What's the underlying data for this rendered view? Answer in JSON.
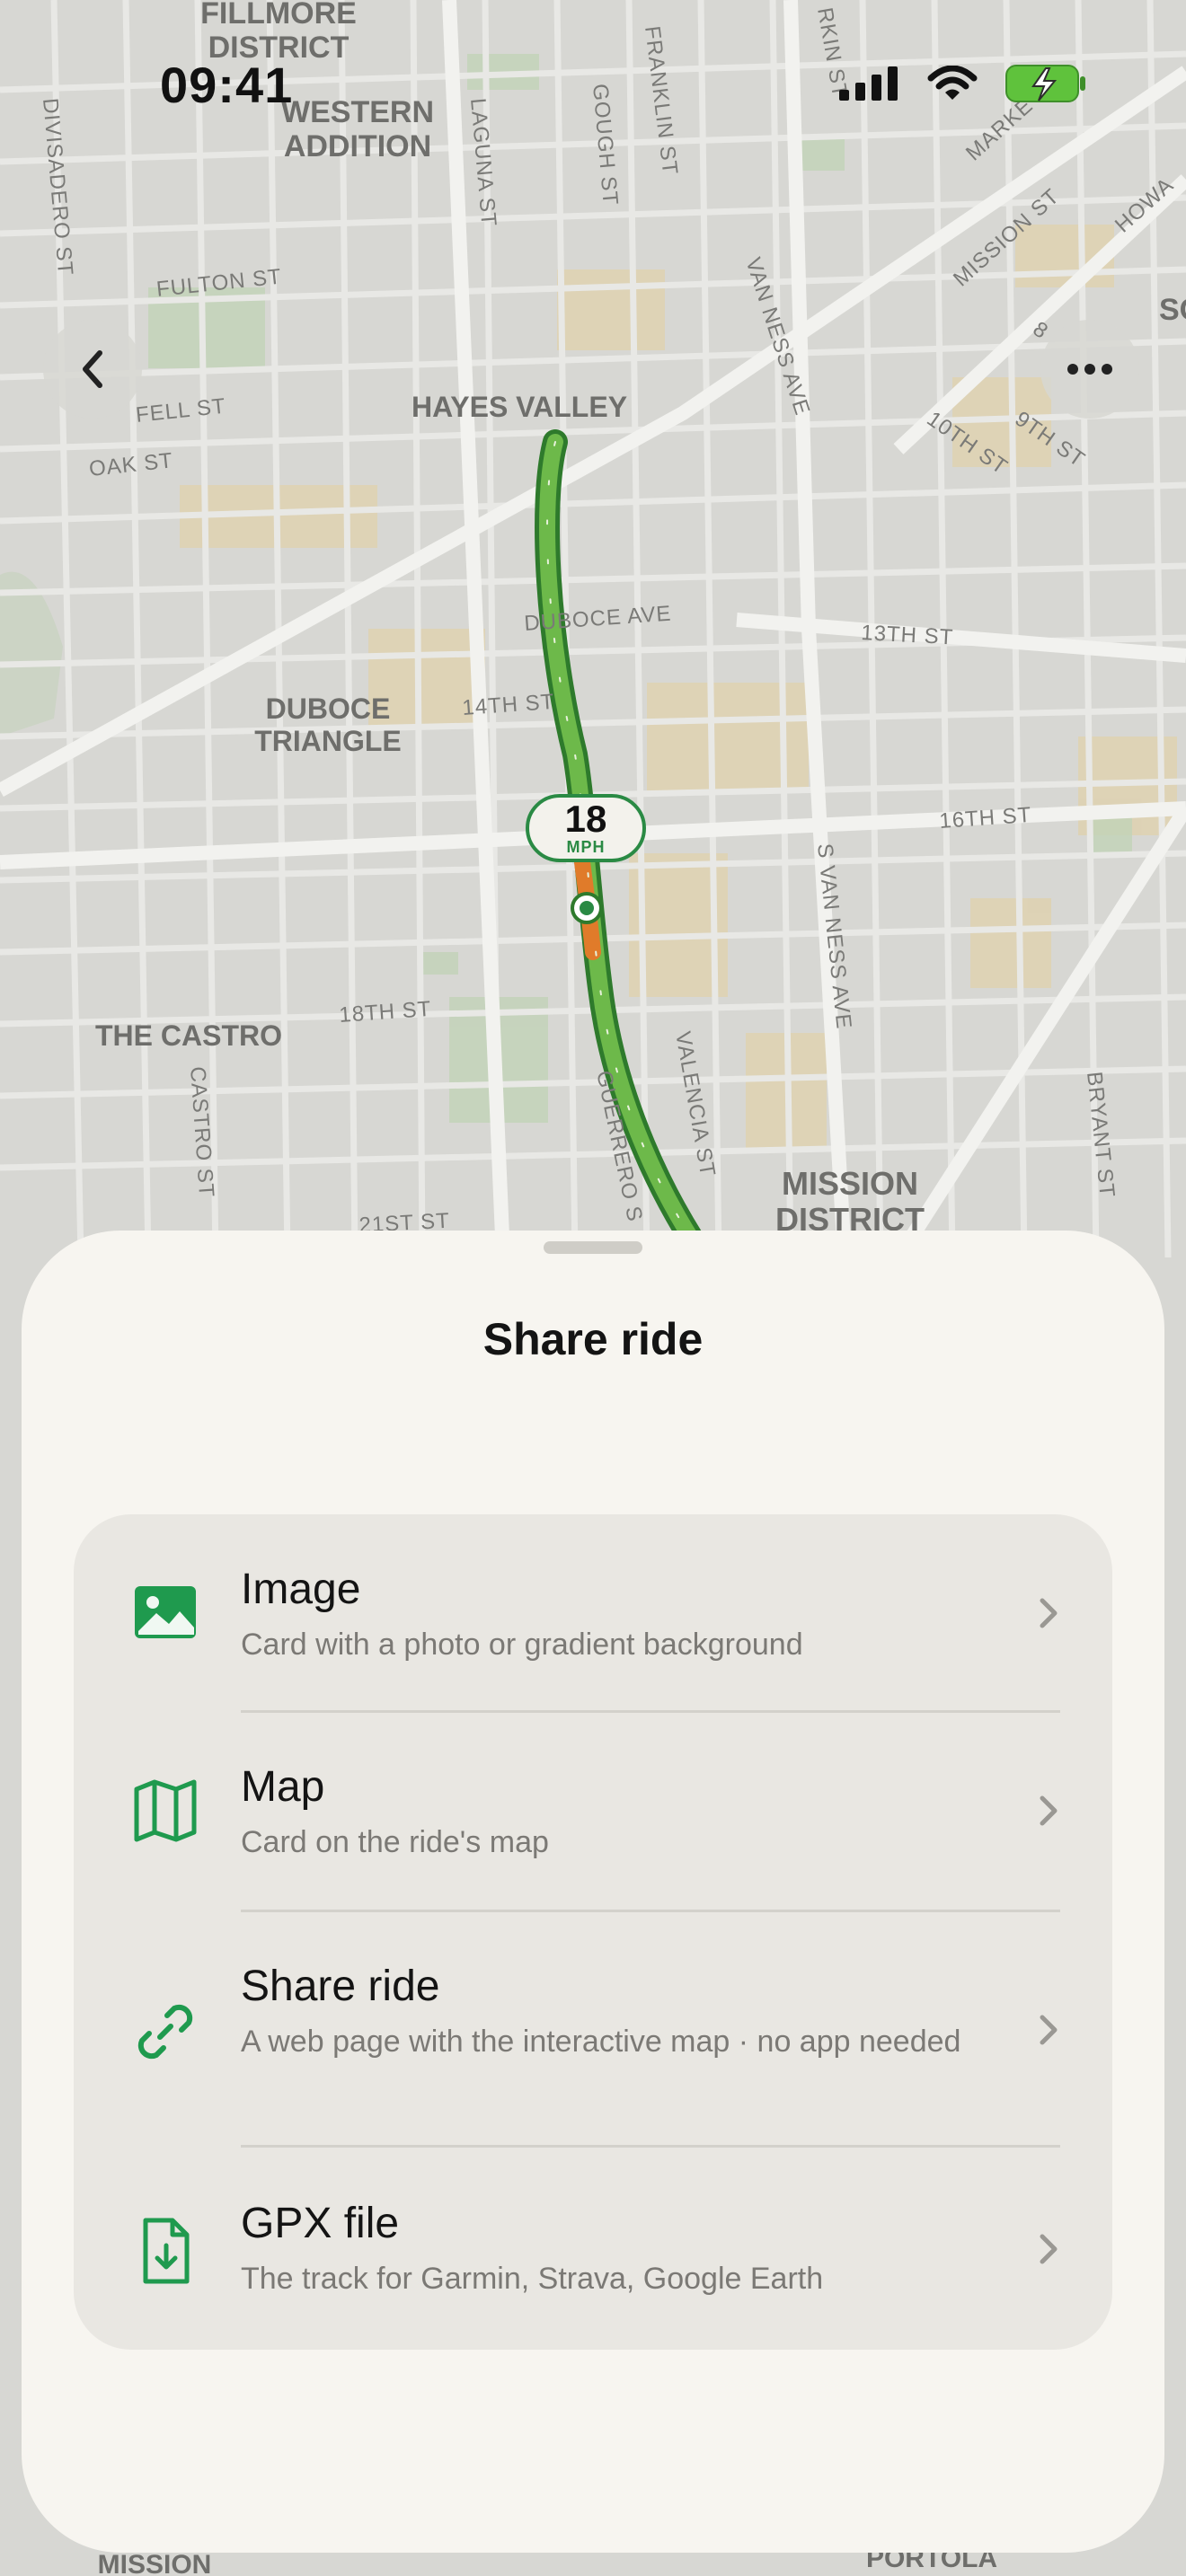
{
  "status_bar": {
    "time": "09:41"
  },
  "map": {
    "labels": {
      "fillmore": "FILLMORE DISTRICT",
      "western_addition": "WESTERN ADDITION",
      "hayes_valley": "HAYES VALLEY",
      "duboce_triangle": "DUBOCE TRIANGLE",
      "the_castro": "THE CASTRO",
      "mission_district": "MISSION DISTRICT",
      "mission_bottom": "MISSION",
      "portola": "PORTOLA",
      "som": "SOM",
      "fulton_st": "FULTON ST",
      "fell_st": "FELL ST",
      "oak_st": "OAK ST",
      "duboce_ave": "DUBOCE AVE",
      "st14": "14TH ST",
      "st13": "13TH ST",
      "st16": "16TH ST",
      "st18": "18TH ST",
      "st21": "21ST ST",
      "st10": "10TH ST",
      "st9": "9TH ST",
      "st8": "8",
      "mission_st": "MISSION ST",
      "market_st": "MARKE",
      "howard": "HOWA",
      "larkin": "RKIN ST",
      "divisadero": "DIVISADERO ST",
      "laguna": "LAGUNA ST",
      "gough": "GOUGH ST",
      "franklin": "FRANKLIN ST",
      "van_ness": "VAN NESS AVE",
      "s_van_ness": "S VAN NESS AVE",
      "valencia": "VALENCIA ST",
      "guerrero": "GUERRERO S",
      "castro": "CASTRO ST",
      "bryant": "BRYANT ST"
    },
    "speed": {
      "value": "18",
      "unit": "MPH"
    },
    "route_color": "#3f9a3c",
    "hot_color": "#e07b2a"
  },
  "sheet": {
    "title": "Share ride",
    "options": [
      {
        "icon": "image-icon",
        "title": "Image",
        "subtitle": "Card with a photo or gradient background"
      },
      {
        "icon": "map-icon",
        "title": "Map",
        "subtitle": "Card on the ride's map"
      },
      {
        "icon": "link-icon",
        "title": "Share ride",
        "subtitle": "A web page with the interactive map · no app needed"
      },
      {
        "icon": "gpx-file-icon",
        "title": "GPX file",
        "subtitle": "The track for Garmin, Strava, Google Earth"
      }
    ]
  },
  "colors": {
    "accent": "#1f9a4e",
    "sheet_bg": "#f7f5f0",
    "card_bg": "#e9e7e2"
  }
}
